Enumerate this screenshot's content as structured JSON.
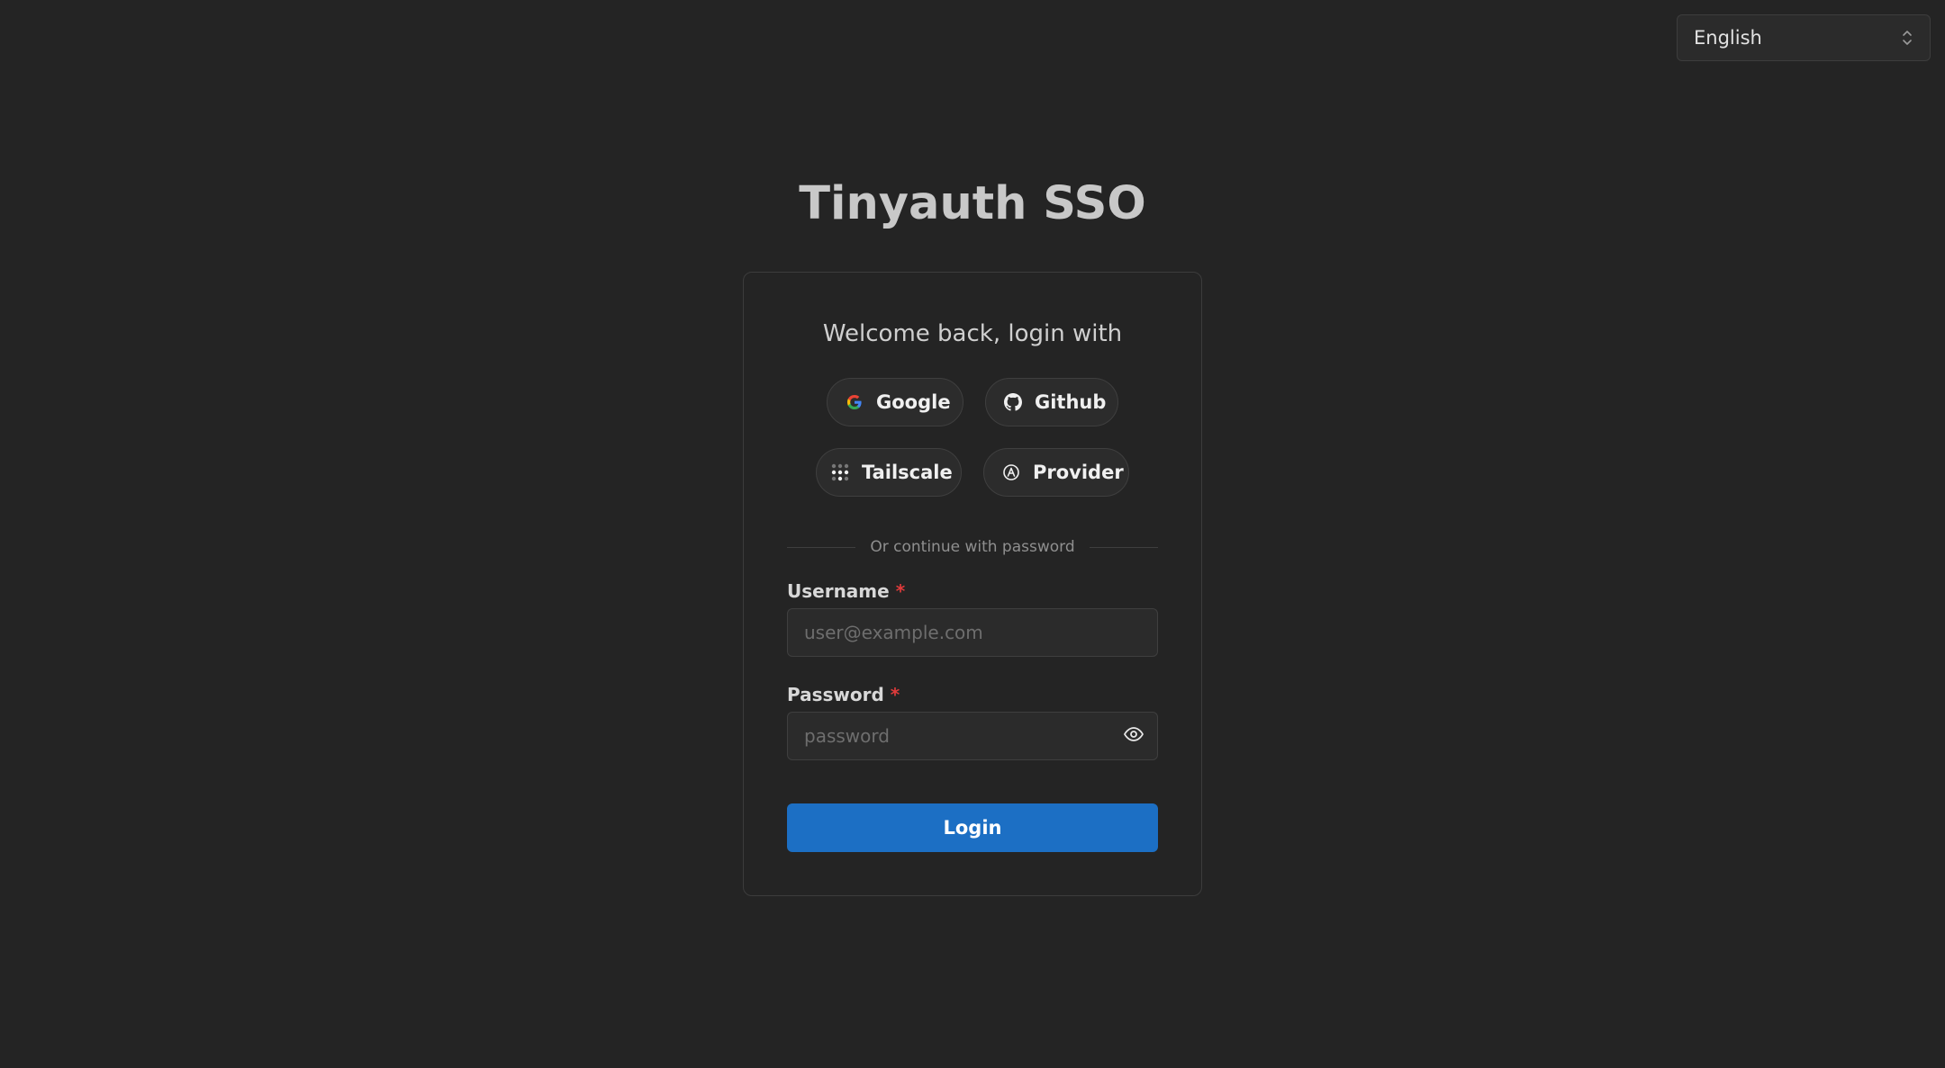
{
  "language_select": {
    "value": "English",
    "icon": "chevrons-up-down-icon"
  },
  "page": {
    "title": "Tinyauth SSO"
  },
  "card": {
    "welcome": "Welcome back, login with",
    "oauth": {
      "google": {
        "label": "Google",
        "icon": "google-icon"
      },
      "github": {
        "label": "Github",
        "icon": "github-icon"
      },
      "tailscale": {
        "label": "Tailscale",
        "icon": "tailscale-icon"
      },
      "provider": {
        "label": "Provider",
        "icon": "openid-icon"
      }
    },
    "divider_text": "Or continue with password",
    "username": {
      "label": "Username",
      "required_mark": "*",
      "placeholder": "user@example.com",
      "value": ""
    },
    "password": {
      "label": "Password",
      "required_mark": "*",
      "placeholder": "password",
      "value": ""
    },
    "login_label": "Login"
  },
  "colors": {
    "background": "#242424",
    "primary": "#1c6fc4",
    "required": "#e03b3b"
  }
}
